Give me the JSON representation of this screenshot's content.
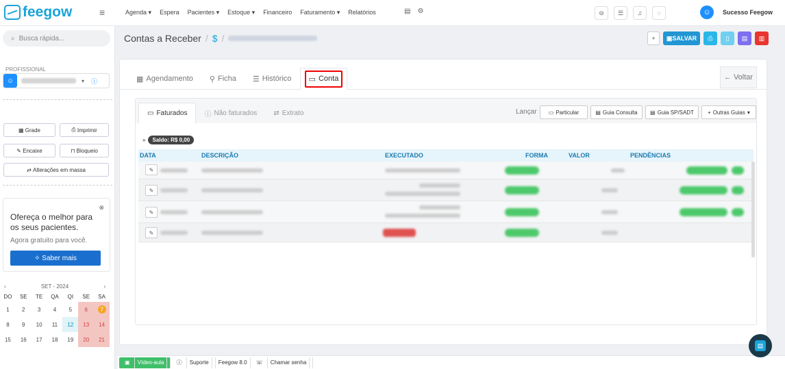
{
  "brand": {
    "name": "feegow"
  },
  "nav": {
    "items": [
      "Agenda ▾",
      "Espera",
      "Pacientes ▾",
      "Estoque ▾",
      "Financeiro",
      "Faturamento ▾",
      "Relatórios"
    ]
  },
  "user": {
    "name": "Sucesso Feegow"
  },
  "sidebar": {
    "search_placeholder": "Busca rápida...",
    "prof_label": "PROFISSIONAL",
    "buttons": {
      "grade": "Grade",
      "imprimir": "Imprimir",
      "encaixe": "Encaixe",
      "bloqueio": "Bloqueio",
      "alteracoes": "Alterações em massa"
    },
    "promo": {
      "title": "Ofereça o melhor para os seus pacientes.",
      "subtitle": "Agora gratuito para você.",
      "button": "Saber mais"
    },
    "calendar": {
      "month": "SET - 2024",
      "dow": [
        "DO",
        "SE",
        "TE",
        "QA",
        "QI",
        "SE",
        "SA"
      ],
      "weeks": [
        [
          "1",
          "2",
          "3",
          "4",
          "5",
          "6",
          "7"
        ],
        [
          "8",
          "9",
          "10",
          "11",
          "12",
          "13",
          "14"
        ],
        [
          "15",
          "16",
          "17",
          "18",
          "19",
          "20",
          "21"
        ]
      ]
    }
  },
  "header": {
    "title": "Contas a Receber",
    "sep": "/",
    "currency": "$",
    "save": "SALVAR",
    "plus": "+"
  },
  "tabs": [
    "Agendamento",
    "Ficha",
    "Histórico",
    "Conta"
  ],
  "voltar": "Voltar",
  "subtabs": [
    "Faturados",
    "Não faturados",
    "Extrato"
  ],
  "lancar": "Lançar",
  "guide_buttons": {
    "particular": "Particular",
    "consulta": "Guia Consulta",
    "sadt": "Guia SP/SADT",
    "outras": "Outras Guias"
  },
  "saldo": "Saldo: R$ 0,00",
  "table": {
    "headers": [
      "DATA",
      "DESCRIÇÃO",
      "EXECUTADO",
      "FORMA",
      "VALOR",
      "PENDÊNCIAS"
    ]
  },
  "footer": {
    "video": "Vídeo-aula",
    "suporte": "Suporte",
    "version": "Feegow 8.0",
    "chamar": "Chamar senha"
  },
  "colors": {
    "brand": "#1aa3d9",
    "highlight": "#e00000",
    "success": "#4dc96b"
  }
}
